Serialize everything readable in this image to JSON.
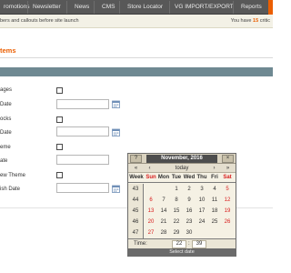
{
  "nav": {
    "items": [
      "romotions",
      "Newsletter",
      "News",
      "CMS",
      "Store Locator",
      "VG IMPORT/EXPORT",
      "Reports"
    ]
  },
  "notice": {
    "left": "bers and callouts before site launch",
    "right_prefix": "You have",
    "right_count": "15",
    "right_suffix": "critic"
  },
  "section": {
    "title": "tems"
  },
  "form": {
    "labels": [
      "ages",
      "Date",
      "ocks",
      "Date",
      "eme",
      "ate",
      "ew Theme",
      "ish Date"
    ]
  },
  "calendar": {
    "help": "?",
    "close": "×",
    "title": "November, 2016",
    "prev_year": "«",
    "prev_month": "‹",
    "today": "today",
    "next_month": "›",
    "next_year": "»",
    "week_label": "Week",
    "days": [
      "Sun",
      "Mon",
      "Tue",
      "Wed",
      "Thu",
      "Fri",
      "Sat"
    ],
    "weeks": [
      "43",
      "44",
      "45",
      "46",
      "47"
    ],
    "rows": [
      [
        "",
        "",
        "1",
        "2",
        "3",
        "4",
        "5"
      ],
      [
        "6",
        "7",
        "8",
        "9",
        "10",
        "11",
        "12"
      ],
      [
        "13",
        "14",
        "15",
        "16",
        "17",
        "18",
        "19"
      ],
      [
        "20",
        "21",
        "22",
        "23",
        "24",
        "25",
        "26"
      ],
      [
        "27",
        "28",
        "29",
        "30",
        "",
        "",
        ""
      ]
    ],
    "time_label": "Time:",
    "hour": "22",
    "minute": "39",
    "footer": "Select date"
  }
}
